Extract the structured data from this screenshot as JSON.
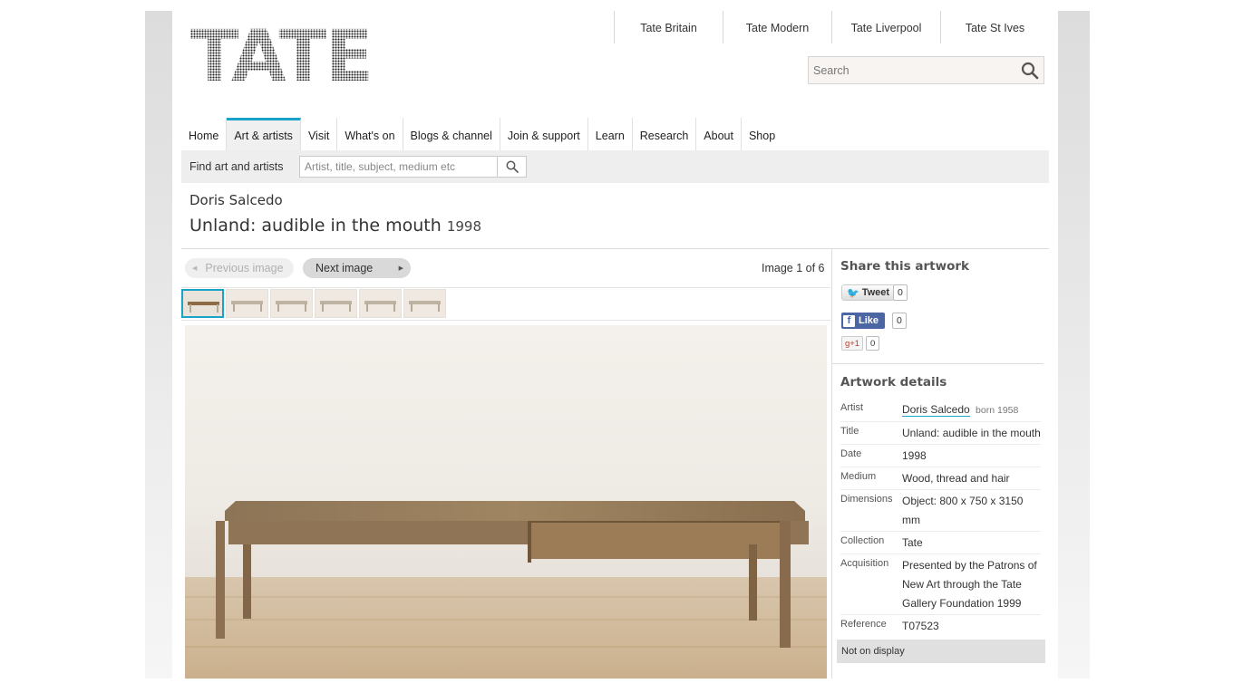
{
  "brand": {
    "logo_text": "TATE"
  },
  "sites": [
    "Tate Britain",
    "Tate Modern",
    "Tate Liverpool",
    "Tate St Ives"
  ],
  "search": {
    "placeholder": "Search"
  },
  "nav": {
    "items": [
      "Home",
      "Art & artists",
      "Visit",
      "What's on",
      "Blogs & channel",
      "Join & support",
      "Learn",
      "Research",
      "About",
      "Shop"
    ],
    "active_index": 1
  },
  "find": {
    "label": "Find art and artists",
    "placeholder": "Artist, title, subject, medium etc"
  },
  "artwork": {
    "artist": "Doris Salcedo",
    "title": "Unland: audible in the mouth",
    "year": "1998"
  },
  "gallery": {
    "prev_label": "Previous image",
    "next_label": "Next image",
    "count_label": "Image 1 of 6"
  },
  "share": {
    "title": "Share this artwork",
    "tweet_label": "Tweet",
    "tweet_count": "0",
    "like_label": "Like",
    "like_count": "0",
    "gplus_label": "g+1",
    "gplus_count": "0"
  },
  "details": {
    "title": "Artwork details",
    "artist_label": "Artist",
    "artist_value": "Doris Salcedo",
    "artist_born": "born 1958",
    "title_label": "Title",
    "title_value": "Unland: audible in the mouth",
    "date_label": "Date",
    "date_value": "1998",
    "medium_label": "Medium",
    "medium_value": "Wood, thread and hair",
    "dimensions_label": "Dimensions",
    "dimensions_value": "Object: 800 x 750 x 3150 mm",
    "collection_label": "Collection",
    "collection_value": "Tate",
    "acquisition_label": "Acquisition",
    "acquisition_value": "Presented by the Patrons of New Art through the Tate Gallery Foundation 1999",
    "reference_label": "Reference",
    "reference_value": "T07523",
    "status": "Not on display"
  },
  "colors": {
    "accent": "#1aa3c9",
    "facebook": "#4c66a4",
    "twitter": "#2ba6de"
  }
}
